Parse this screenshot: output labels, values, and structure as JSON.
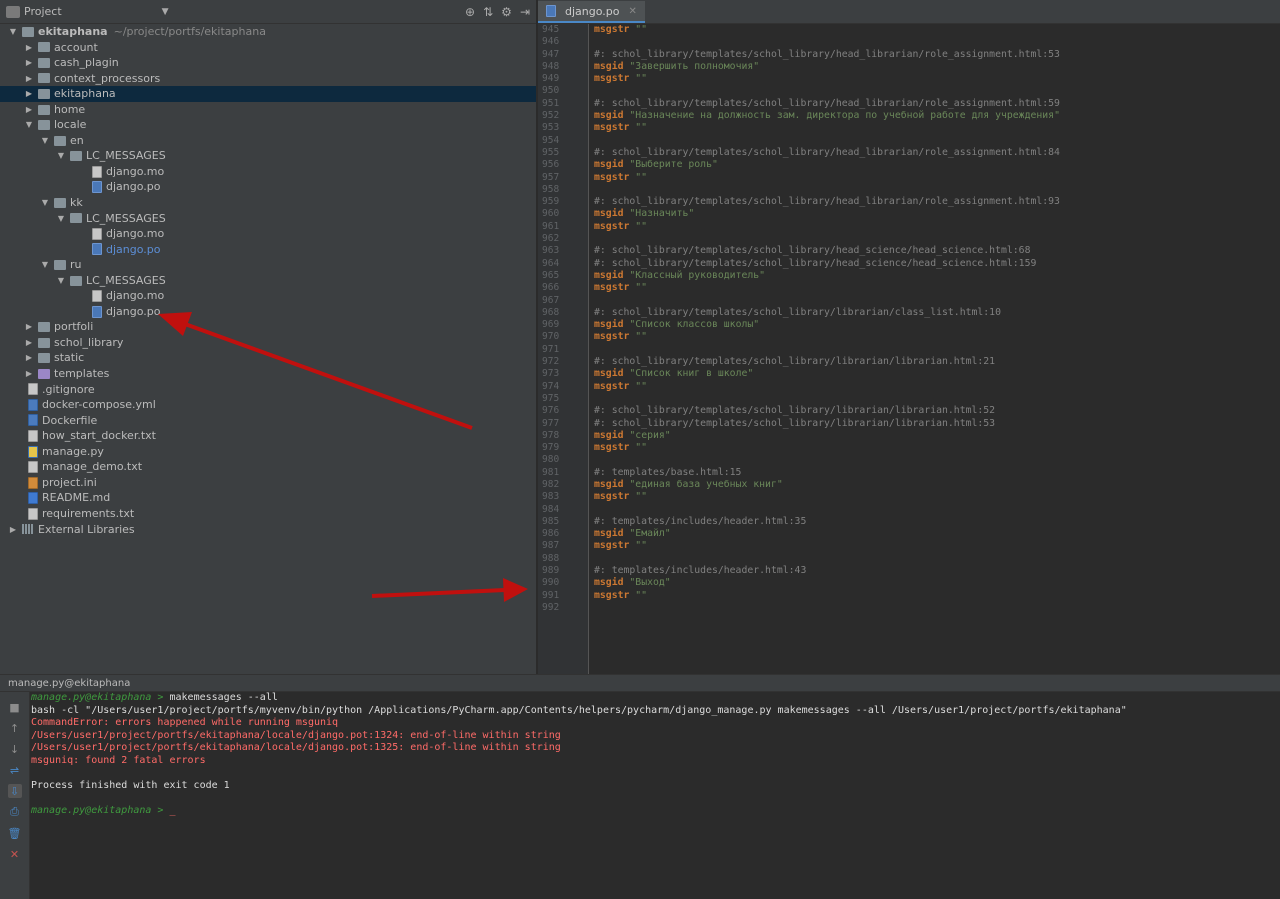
{
  "project_panel": {
    "title": "Project",
    "tree": [
      {
        "depth": 0,
        "arrow": "▼",
        "icon": "folder",
        "label": "ekitaphana",
        "path": "~/project/portfs/ekitaphana",
        "bold": true
      },
      {
        "depth": 1,
        "arrow": "▶",
        "icon": "folder",
        "label": "account"
      },
      {
        "depth": 1,
        "arrow": "▶",
        "icon": "folder",
        "label": "cash_plagin"
      },
      {
        "depth": 1,
        "arrow": "▶",
        "icon": "folder",
        "label": "context_processors"
      },
      {
        "depth": 1,
        "arrow": "▶",
        "icon": "folder",
        "label": "ekitaphana",
        "selected": true
      },
      {
        "depth": 1,
        "arrow": "▶",
        "icon": "folder",
        "label": "home"
      },
      {
        "depth": 1,
        "arrow": "▼",
        "icon": "folder",
        "label": "locale"
      },
      {
        "depth": 2,
        "arrow": "▼",
        "icon": "folder",
        "label": "en"
      },
      {
        "depth": 3,
        "arrow": "▼",
        "icon": "folder",
        "label": "LC_MESSAGES"
      },
      {
        "depth": 4,
        "arrow": "",
        "icon": "file",
        "label": "django.mo"
      },
      {
        "depth": 4,
        "arrow": "",
        "icon": "po",
        "label": "django.po"
      },
      {
        "depth": 2,
        "arrow": "▼",
        "icon": "folder",
        "label": "kk"
      },
      {
        "depth": 3,
        "arrow": "▼",
        "icon": "folder",
        "label": "LC_MESSAGES"
      },
      {
        "depth": 4,
        "arrow": "",
        "icon": "file",
        "label": "django.mo"
      },
      {
        "depth": 4,
        "arrow": "",
        "icon": "po",
        "label": "django.po",
        "blue": true
      },
      {
        "depth": 2,
        "arrow": "▼",
        "icon": "folder",
        "label": "ru"
      },
      {
        "depth": 3,
        "arrow": "▼",
        "icon": "folder",
        "label": "LC_MESSAGES"
      },
      {
        "depth": 4,
        "arrow": "",
        "icon": "file",
        "label": "django.mo"
      },
      {
        "depth": 4,
        "arrow": "",
        "icon": "po",
        "label": "django.po"
      },
      {
        "depth": 1,
        "arrow": "▶",
        "icon": "folder",
        "label": "portfoli"
      },
      {
        "depth": 1,
        "arrow": "▶",
        "icon": "folder",
        "label": "schol_library"
      },
      {
        "depth": 1,
        "arrow": "▶",
        "icon": "folder",
        "label": "static"
      },
      {
        "depth": 1,
        "arrow": "▶",
        "icon": "folder-purple",
        "label": "templates"
      },
      {
        "depth": 1,
        "arrow": "",
        "icon": "file",
        "label": ".gitignore"
      },
      {
        "depth": 1,
        "arrow": "",
        "icon": "yml",
        "label": "docker-compose.yml"
      },
      {
        "depth": 1,
        "arrow": "",
        "icon": "yml",
        "label": "Dockerfile"
      },
      {
        "depth": 1,
        "arrow": "",
        "icon": "file",
        "label": "how_start_docker.txt"
      },
      {
        "depth": 1,
        "arrow": "",
        "icon": "py",
        "label": "manage.py"
      },
      {
        "depth": 1,
        "arrow": "",
        "icon": "file",
        "label": "manage_demo.txt"
      },
      {
        "depth": 1,
        "arrow": "",
        "icon": "ini",
        "label": "project.ini"
      },
      {
        "depth": 1,
        "arrow": "",
        "icon": "md",
        "label": "README.md"
      },
      {
        "depth": 1,
        "arrow": "",
        "icon": "file",
        "label": "requirements.txt"
      },
      {
        "depth": 0,
        "arrow": "▶",
        "icon": "lib",
        "label": "External Libraries"
      }
    ]
  },
  "editor": {
    "tab_label": "django.po",
    "lines": [
      {
        "n": "945",
        "parts": [
          [
            "kw",
            "msgstr"
          ],
          [
            "str",
            " \"\""
          ]
        ]
      },
      {
        "n": "946",
        "parts": []
      },
      {
        "n": "947",
        "parts": [
          [
            "comment",
            "#: schol_library/templates/schol_library/head_librarian/role_assignment.html:53"
          ]
        ]
      },
      {
        "n": "948",
        "parts": [
          [
            "kw",
            "msgid"
          ],
          [
            "str",
            " \"Завершить полномочия\""
          ]
        ]
      },
      {
        "n": "949",
        "parts": [
          [
            "kw",
            "msgstr"
          ],
          [
            "str",
            " \"\""
          ]
        ]
      },
      {
        "n": "950",
        "parts": []
      },
      {
        "n": "951",
        "parts": [
          [
            "comment",
            "#: schol_library/templates/schol_library/head_librarian/role_assignment.html:59"
          ]
        ]
      },
      {
        "n": "952",
        "parts": [
          [
            "kw",
            "msgid"
          ],
          [
            "str",
            " \"Назначение на должность зам. директора по учебной работе для учреждения\""
          ]
        ]
      },
      {
        "n": "953",
        "parts": [
          [
            "kw",
            "msgstr"
          ],
          [
            "str",
            " \"\""
          ]
        ]
      },
      {
        "n": "954",
        "parts": []
      },
      {
        "n": "955",
        "parts": [
          [
            "comment",
            "#: schol_library/templates/schol_library/head_librarian/role_assignment.html:84"
          ]
        ]
      },
      {
        "n": "956",
        "parts": [
          [
            "kw",
            "msgid"
          ],
          [
            "str",
            " \"Выберите роль\""
          ]
        ]
      },
      {
        "n": "957",
        "parts": [
          [
            "kw",
            "msgstr"
          ],
          [
            "str",
            " \"\""
          ]
        ]
      },
      {
        "n": "958",
        "parts": []
      },
      {
        "n": "959",
        "parts": [
          [
            "comment",
            "#: schol_library/templates/schol_library/head_librarian/role_assignment.html:93"
          ]
        ]
      },
      {
        "n": "960",
        "parts": [
          [
            "kw",
            "msgid"
          ],
          [
            "str",
            " \"Назначить\""
          ]
        ]
      },
      {
        "n": "961",
        "parts": [
          [
            "kw",
            "msgstr"
          ],
          [
            "str",
            " \"\""
          ]
        ]
      },
      {
        "n": "962",
        "parts": []
      },
      {
        "n": "963",
        "parts": [
          [
            "comment",
            "#: schol_library/templates/schol_library/head_science/head_science.html:68"
          ]
        ]
      },
      {
        "n": "964",
        "parts": [
          [
            "comment",
            "#: schol_library/templates/schol_library/head_science/head_science.html:159"
          ]
        ]
      },
      {
        "n": "965",
        "parts": [
          [
            "kw",
            "msgid"
          ],
          [
            "str",
            " \"Классный руководитель\""
          ]
        ]
      },
      {
        "n": "966",
        "parts": [
          [
            "kw",
            "msgstr"
          ],
          [
            "str",
            " \"\""
          ]
        ]
      },
      {
        "n": "967",
        "parts": []
      },
      {
        "n": "968",
        "parts": [
          [
            "comment",
            "#: schol_library/templates/schol_library/librarian/class_list.html:10"
          ]
        ]
      },
      {
        "n": "969",
        "parts": [
          [
            "kw",
            "msgid"
          ],
          [
            "str",
            " \"Список классов школы\""
          ]
        ]
      },
      {
        "n": "970",
        "parts": [
          [
            "kw",
            "msgstr"
          ],
          [
            "str",
            " \"\""
          ]
        ]
      },
      {
        "n": "971",
        "parts": []
      },
      {
        "n": "972",
        "parts": [
          [
            "comment",
            "#: schol_library/templates/schol_library/librarian/librarian.html:21"
          ]
        ]
      },
      {
        "n": "973",
        "parts": [
          [
            "kw",
            "msgid"
          ],
          [
            "str",
            " \"Список книг в школе\""
          ]
        ]
      },
      {
        "n": "974",
        "parts": [
          [
            "kw",
            "msgstr"
          ],
          [
            "str",
            " \"\""
          ]
        ]
      },
      {
        "n": "975",
        "parts": []
      },
      {
        "n": "976",
        "parts": [
          [
            "comment",
            "#: schol_library/templates/schol_library/librarian/librarian.html:52"
          ]
        ]
      },
      {
        "n": "977",
        "parts": [
          [
            "comment",
            "#: schol_library/templates/schol_library/librarian/librarian.html:53"
          ]
        ]
      },
      {
        "n": "978",
        "parts": [
          [
            "kw",
            "msgid"
          ],
          [
            "str",
            " \"серия\""
          ]
        ]
      },
      {
        "n": "979",
        "parts": [
          [
            "kw",
            "msgstr"
          ],
          [
            "str",
            " \"\""
          ]
        ]
      },
      {
        "n": "980",
        "parts": []
      },
      {
        "n": "981",
        "parts": [
          [
            "comment",
            "#: templates/base.html:15"
          ]
        ]
      },
      {
        "n": "982",
        "parts": [
          [
            "kw",
            "msgid"
          ],
          [
            "str",
            " \"единая база учебных книг\""
          ]
        ]
      },
      {
        "n": "983",
        "parts": [
          [
            "kw",
            "msgstr"
          ],
          [
            "str",
            " \"\""
          ]
        ]
      },
      {
        "n": "984",
        "parts": []
      },
      {
        "n": "985",
        "parts": [
          [
            "comment",
            "#: templates/includes/header.html:35"
          ]
        ]
      },
      {
        "n": "986",
        "parts": [
          [
            "kw",
            "msgid"
          ],
          [
            "str",
            " \"Емайл\""
          ]
        ]
      },
      {
        "n": "987",
        "parts": [
          [
            "kw",
            "msgstr"
          ],
          [
            "str",
            " \"\""
          ]
        ]
      },
      {
        "n": "988",
        "parts": []
      },
      {
        "n": "989",
        "parts": [
          [
            "comment",
            "#: templates/includes/header.html:43"
          ]
        ]
      },
      {
        "n": "990",
        "parts": [
          [
            "kw",
            "msgid"
          ],
          [
            "str",
            " \"Выход\""
          ]
        ]
      },
      {
        "n": "991",
        "parts": [
          [
            "kw",
            "msgstr"
          ],
          [
            "str",
            " \"\""
          ]
        ]
      },
      {
        "n": "992",
        "parts": []
      }
    ]
  },
  "run_panel": {
    "title": "manage.py@ekitaphana",
    "lines": [
      [
        [
          "prompt",
          "manage.py@ekitaphana > "
        ],
        [
          "plain",
          "makemessages --all"
        ]
      ],
      [
        [
          "plain",
          "bash -cl \"/Users/user1/project/portfs/myvenv/bin/python /Applications/PyCharm.app/Contents/helpers/pycharm/django_manage.py makemessages --all /Users/user1/project/portfs/ekitaphana\""
        ]
      ],
      [
        [
          "err",
          "CommandError: errors happened while running msguniq"
        ]
      ],
      [
        [
          "err",
          "/Users/user1/project/portfs/ekitaphana/locale/django.pot:1324: end-of-line within string"
        ]
      ],
      [
        [
          "err",
          "/Users/user1/project/portfs/ekitaphana/locale/django.pot:1325: end-of-line within string"
        ]
      ],
      [
        [
          "err",
          "msguniq: found 2 fatal errors"
        ]
      ],
      [],
      [
        [
          "plain",
          "Process finished with exit code 1"
        ]
      ],
      [],
      [
        [
          "prompt",
          "manage.py@ekitaphana > "
        ],
        [
          "cursor",
          "_"
        ]
      ]
    ]
  },
  "colors": {
    "annotation_arrow": "#c0100e"
  }
}
